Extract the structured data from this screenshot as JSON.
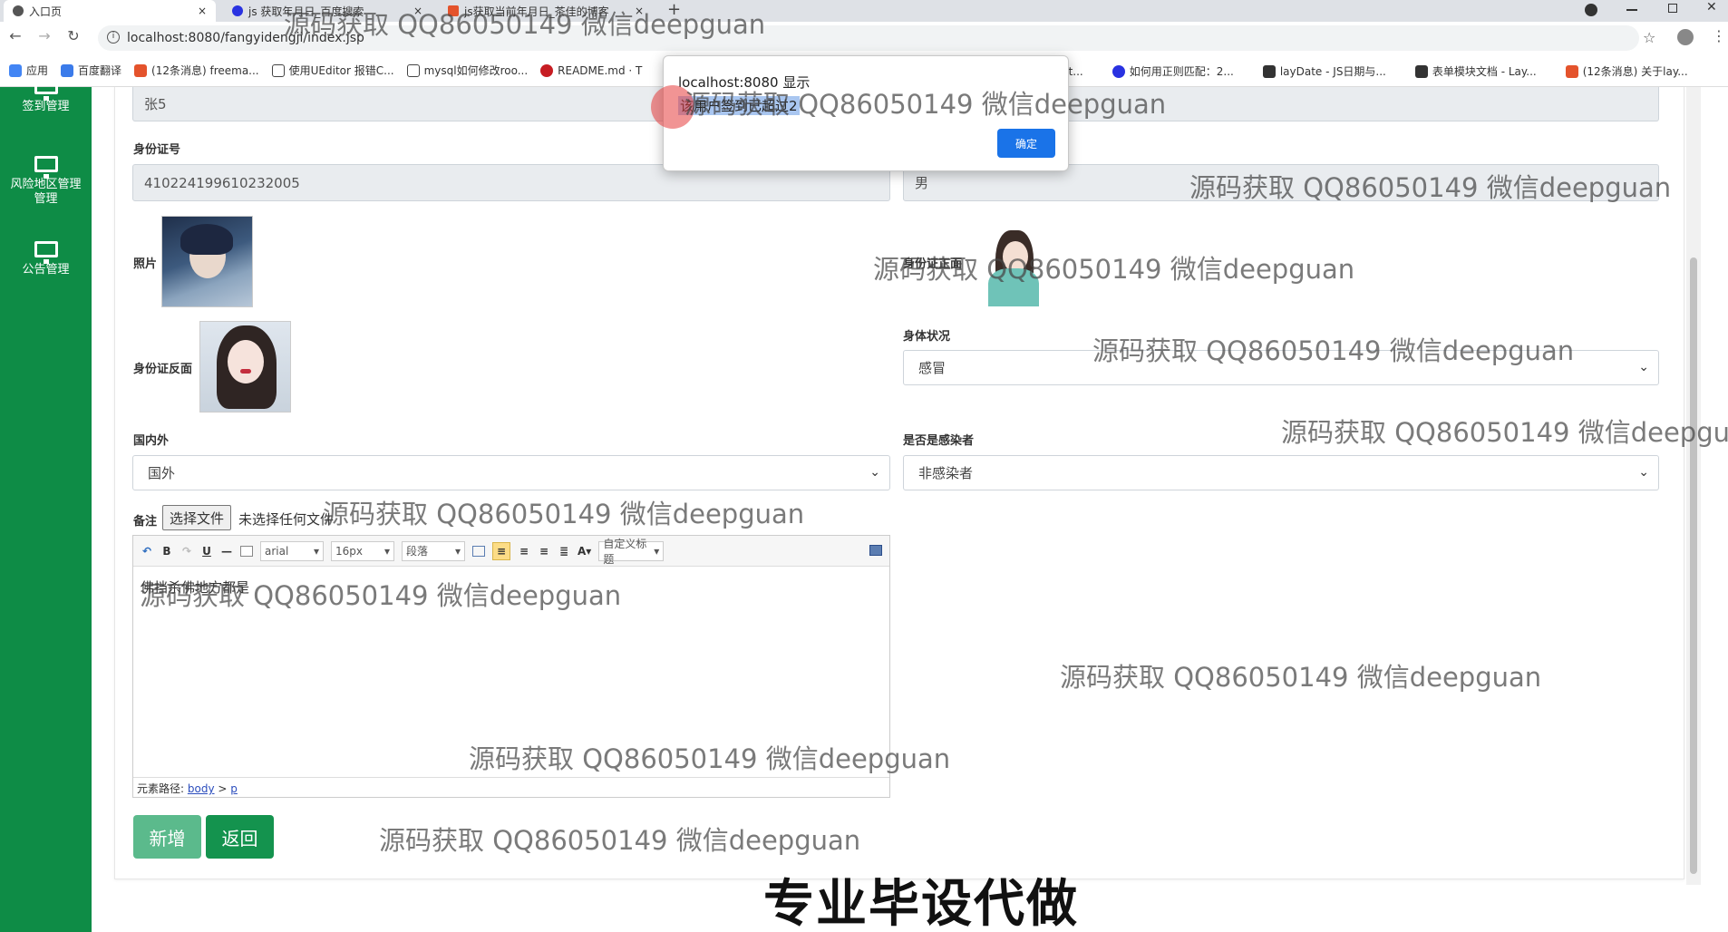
{
  "tabs": [
    {
      "label": "入口页",
      "close": "×"
    },
    {
      "label": "js 获取年月日_百度搜索",
      "close": "×"
    },
    {
      "label": "js获取当前年月日_茶佳的博客",
      "close": "×"
    }
  ],
  "new_tab": "+",
  "address": {
    "url": "localhost:8080/fangyidengji/index.jsp"
  },
  "bookmarks": [
    {
      "label": "应用",
      "color": "#4285f4"
    },
    {
      "label": "百度翻译",
      "color": "#3b7bea"
    },
    {
      "label": "(12条消息) freema...",
      "color": "#e4532c"
    },
    {
      "label": "使用UEditor 报错C...",
      "color": "#444444"
    },
    {
      "label": "mysql如何修改roo...",
      "color": "#444444"
    },
    {
      "label": "README.md · T",
      "color": "#c71d23"
    }
  ],
  "bookmarks_right": [
    {
      "label": "ct...",
      "color": "#ffffff"
    },
    {
      "label": "如何用正则匹配：2...",
      "color": "#2932e1"
    },
    {
      "label": "layDate - JS日期与...",
      "color": "#333333"
    },
    {
      "label": "表单模块文档 - Lay...",
      "color": "#333333"
    },
    {
      "label": "(12条消息) 关于lay...",
      "color": "#e4532c"
    }
  ],
  "sidebar": {
    "items": [
      {
        "label": "签到管理"
      },
      {
        "label": "风险地区管理管理"
      },
      {
        "label": "公告管理"
      }
    ]
  },
  "form": {
    "name_value": "张5",
    "id_label": "身份证号",
    "id_value": "410224199610232005",
    "gender_value": "男",
    "photo_label": "照片",
    "id_front_label": "身份证正面",
    "id_back_label": "身份证反面",
    "health_label": "身体状况",
    "health_value": "感冒",
    "domestic_label": "国内外",
    "domestic_value": "国外",
    "infected_label": "是否是感染者",
    "infected_value": "非感染者",
    "remark_label": "备注",
    "file_button": "选择文件",
    "file_status": "未选择任何文件",
    "editor_content": "佛挡杀佛地方都是",
    "path_prefix": "元素路径:",
    "path_body": "body",
    "path_sep": ">",
    "path_p": "p",
    "add_button": "新增",
    "back_button": "返回"
  },
  "toolbar": {
    "undo": "↶",
    "bold": "B",
    "redo": "↷",
    "underline": "U",
    "hr": "—",
    "font_family": "arial",
    "font_size": "16px",
    "paragraph": "段落",
    "font_color": "A",
    "custom_title": "自定义标题"
  },
  "alert": {
    "title": "localhost:8080 显示",
    "message": "该用户签到已超过2",
    "ok": "确定"
  },
  "watermarks": [
    "源码获取 QQ86050149 微信deepguan",
    "源码获取 QQ86050149 微信deepguan",
    "源码获取 QQ86050149 微信deepguan",
    "源码获取 QQ86050149 微信deepguan",
    "源码获取 QQ86050149 微信deepguan",
    "源码获取 QQ86050149 微信deepgu",
    "源码获取 QQ86050149 微信deepguan",
    "源码获取 QQ86050149 微信deepguan",
    "源码获取 QQ86050149 微信deepguan",
    "源码获取 QQ86050149 微信deepguan",
    "源码获取 QQ86050149 微信deepguan"
  ],
  "banner": "专业毕设代做",
  "colors": {
    "sidebar": "#0e8c46",
    "primary_button": "#1a73e8",
    "add_button": "#3fae78",
    "back_button": "#14934e"
  }
}
